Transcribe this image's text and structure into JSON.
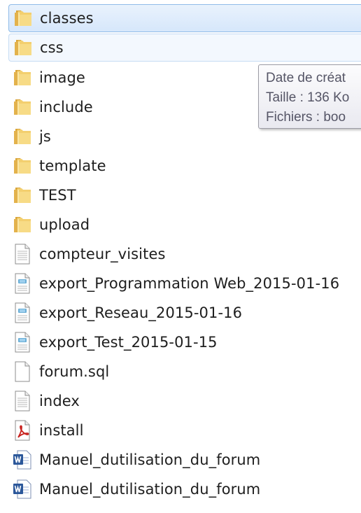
{
  "items": [
    {
      "name": "classes",
      "type": "folder",
      "state": "selected"
    },
    {
      "name": "css",
      "type": "folder",
      "state": "hover"
    },
    {
      "name": "image",
      "type": "folder"
    },
    {
      "name": "include",
      "type": "folder"
    },
    {
      "name": "js",
      "type": "folder"
    },
    {
      "name": "template",
      "type": "folder"
    },
    {
      "name": "TEST",
      "type": "folder"
    },
    {
      "name": "upload",
      "type": "folder"
    },
    {
      "name": "compteur_visites",
      "type": "text-file"
    },
    {
      "name": "export_Programmation Web_2015-01-16",
      "type": "registry-file"
    },
    {
      "name": "export_Reseau_2015-01-16",
      "type": "registry-file"
    },
    {
      "name": "export_Test_2015-01-15",
      "type": "registry-file"
    },
    {
      "name": "forum.sql",
      "type": "blank-file"
    },
    {
      "name": "index",
      "type": "text-file"
    },
    {
      "name": "install",
      "type": "pdf-file"
    },
    {
      "name": "Manuel_dutilisation_du_forum",
      "type": "word-file"
    },
    {
      "name": "Manuel_dutilisation_du_forum",
      "type": "word-file"
    }
  ],
  "tooltip": {
    "line1": "Date de créat",
    "line2": "Taille : 136 Ko",
    "line3": "Fichiers : boo"
  },
  "colors": {
    "selection_bg": "#d6e7fb",
    "selection_border": "#8fbbe8",
    "folder": "#e8b84a",
    "pdf": "#c8201d",
    "word": "#2b579a"
  }
}
